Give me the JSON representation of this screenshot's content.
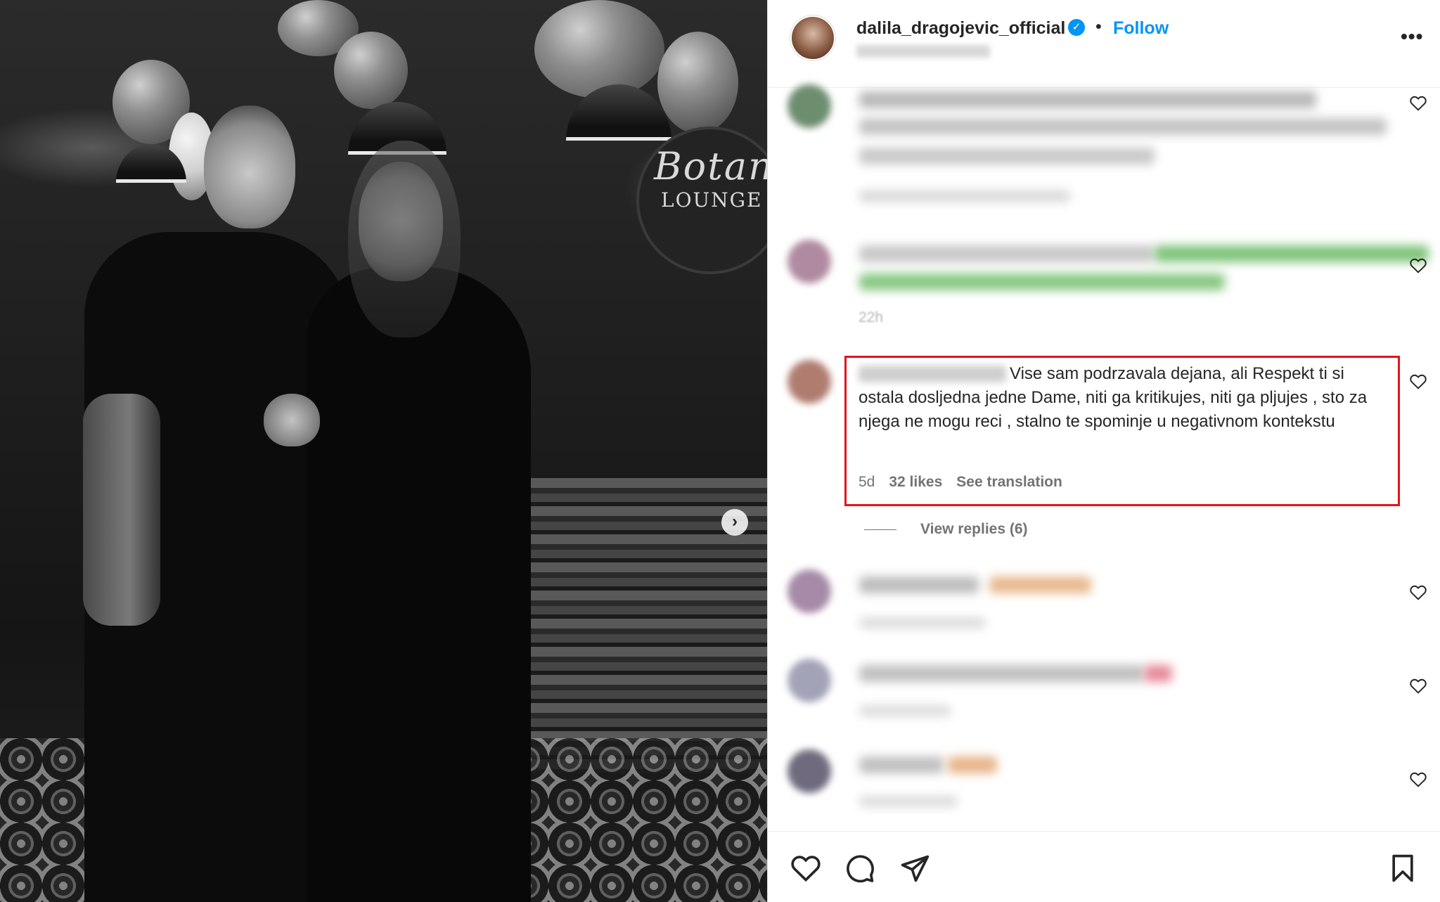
{
  "post": {
    "username": "dalila_dragojevic_official",
    "verified_badge": "✓",
    "separator": "•",
    "follow_label": "Follow",
    "more_label": "•••"
  },
  "photo": {
    "sign_script": "Botani",
    "sign_word": "LOUNGE",
    "next_label": "›"
  },
  "comments": [
    {
      "id": 1,
      "blurred": true,
      "avatar_color": "#6d8d6f"
    },
    {
      "id": 2,
      "blurred": true,
      "avatar_color": "#b08aa0",
      "time": "22h"
    },
    {
      "id": 3,
      "blurred": false,
      "avatar_color": "#b07c70",
      "text": "Vise sam podrzavala dejana, ali Respekt ti si ostala dosljedna jedne Dame, niti ga kritikujes, niti ga pljujes , sto za njega ne mogu reci , stalno te spominje u negativnom kontekstu",
      "time": "5d",
      "likes": "32 likes",
      "translate": "See translation",
      "replies": "View replies (6)"
    },
    {
      "id": 4,
      "blurred": true,
      "avatar_color": "#a68aa8"
    },
    {
      "id": 5,
      "blurred": true,
      "avatar_color": "#a3a3b8",
      "time": "5d"
    },
    {
      "id": 6,
      "blurred": true,
      "avatar_color": "#6f6a7e"
    }
  ],
  "icons": {
    "heart": "heart-icon",
    "comment": "comment-bubble-icon",
    "share": "paper-plane-icon",
    "save": "bookmark-icon"
  },
  "colors": {
    "follow": "#0095f6",
    "highlight": "#e3131b",
    "meta": "#737373",
    "text": "#262626"
  }
}
